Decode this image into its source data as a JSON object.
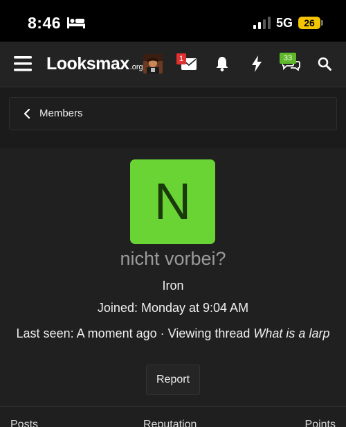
{
  "status_bar": {
    "time": "8:46",
    "network": "5G",
    "battery": "26"
  },
  "navbar": {
    "logo": {
      "main": "Looksmax",
      "tld": ".org"
    },
    "mail_badge": "1",
    "chat_badge": "33"
  },
  "breadcrumb": {
    "label": "Members"
  },
  "profile": {
    "avatar_letter": "N",
    "avatar_color": "#6ad434",
    "username": "nicht vorbei?",
    "rank": "Iron",
    "joined": "Joined: Monday at 9:04 AM",
    "last_seen_prefix": "Last seen: A moment ago · Viewing thread ",
    "last_seen_thread": "What is a larp",
    "report_label": "Report"
  },
  "stats": {
    "posts_label": "Posts",
    "reputation_label": "Reputation",
    "points_label": "Points"
  },
  "colors": {
    "badge_red": "#e03030",
    "badge_green": "#5fb82a"
  }
}
